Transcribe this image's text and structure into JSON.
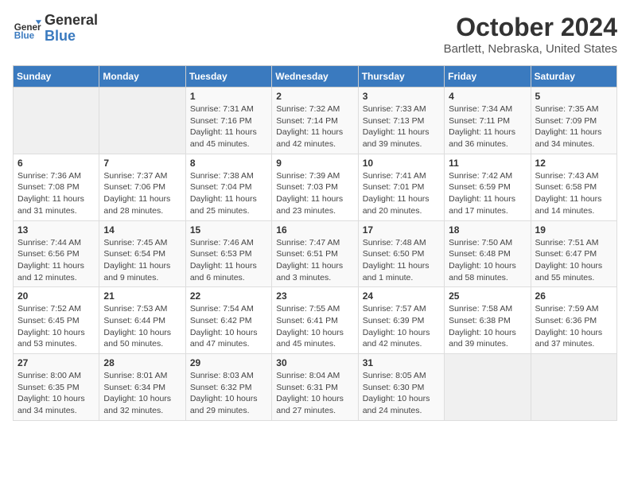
{
  "header": {
    "logo": {
      "general": "General",
      "blue": "Blue"
    },
    "title": "October 2024",
    "location": "Bartlett, Nebraska, United States"
  },
  "days_of_week": [
    "Sunday",
    "Monday",
    "Tuesday",
    "Wednesday",
    "Thursday",
    "Friday",
    "Saturday"
  ],
  "weeks": [
    [
      {
        "day": null
      },
      {
        "day": null
      },
      {
        "day": 1,
        "sunrise": "7:31 AM",
        "sunset": "7:16 PM",
        "daylight": "11 hours and 45 minutes."
      },
      {
        "day": 2,
        "sunrise": "7:32 AM",
        "sunset": "7:14 PM",
        "daylight": "11 hours and 42 minutes."
      },
      {
        "day": 3,
        "sunrise": "7:33 AM",
        "sunset": "7:13 PM",
        "daylight": "11 hours and 39 minutes."
      },
      {
        "day": 4,
        "sunrise": "7:34 AM",
        "sunset": "7:11 PM",
        "daylight": "11 hours and 36 minutes."
      },
      {
        "day": 5,
        "sunrise": "7:35 AM",
        "sunset": "7:09 PM",
        "daylight": "11 hours and 34 minutes."
      }
    ],
    [
      {
        "day": 6,
        "sunrise": "7:36 AM",
        "sunset": "7:08 PM",
        "daylight": "11 hours and 31 minutes."
      },
      {
        "day": 7,
        "sunrise": "7:37 AM",
        "sunset": "7:06 PM",
        "daylight": "11 hours and 28 minutes."
      },
      {
        "day": 8,
        "sunrise": "7:38 AM",
        "sunset": "7:04 PM",
        "daylight": "11 hours and 25 minutes."
      },
      {
        "day": 9,
        "sunrise": "7:39 AM",
        "sunset": "7:03 PM",
        "daylight": "11 hours and 23 minutes."
      },
      {
        "day": 10,
        "sunrise": "7:41 AM",
        "sunset": "7:01 PM",
        "daylight": "11 hours and 20 minutes."
      },
      {
        "day": 11,
        "sunrise": "7:42 AM",
        "sunset": "6:59 PM",
        "daylight": "11 hours and 17 minutes."
      },
      {
        "day": 12,
        "sunrise": "7:43 AM",
        "sunset": "6:58 PM",
        "daylight": "11 hours and 14 minutes."
      }
    ],
    [
      {
        "day": 13,
        "sunrise": "7:44 AM",
        "sunset": "6:56 PM",
        "daylight": "11 hours and 12 minutes."
      },
      {
        "day": 14,
        "sunrise": "7:45 AM",
        "sunset": "6:54 PM",
        "daylight": "11 hours and 9 minutes."
      },
      {
        "day": 15,
        "sunrise": "7:46 AM",
        "sunset": "6:53 PM",
        "daylight": "11 hours and 6 minutes."
      },
      {
        "day": 16,
        "sunrise": "7:47 AM",
        "sunset": "6:51 PM",
        "daylight": "11 hours and 3 minutes."
      },
      {
        "day": 17,
        "sunrise": "7:48 AM",
        "sunset": "6:50 PM",
        "daylight": "11 hours and 1 minute."
      },
      {
        "day": 18,
        "sunrise": "7:50 AM",
        "sunset": "6:48 PM",
        "daylight": "10 hours and 58 minutes."
      },
      {
        "day": 19,
        "sunrise": "7:51 AM",
        "sunset": "6:47 PM",
        "daylight": "10 hours and 55 minutes."
      }
    ],
    [
      {
        "day": 20,
        "sunrise": "7:52 AM",
        "sunset": "6:45 PM",
        "daylight": "10 hours and 53 minutes."
      },
      {
        "day": 21,
        "sunrise": "7:53 AM",
        "sunset": "6:44 PM",
        "daylight": "10 hours and 50 minutes."
      },
      {
        "day": 22,
        "sunrise": "7:54 AM",
        "sunset": "6:42 PM",
        "daylight": "10 hours and 47 minutes."
      },
      {
        "day": 23,
        "sunrise": "7:55 AM",
        "sunset": "6:41 PM",
        "daylight": "10 hours and 45 minutes."
      },
      {
        "day": 24,
        "sunrise": "7:57 AM",
        "sunset": "6:39 PM",
        "daylight": "10 hours and 42 minutes."
      },
      {
        "day": 25,
        "sunrise": "7:58 AM",
        "sunset": "6:38 PM",
        "daylight": "10 hours and 39 minutes."
      },
      {
        "day": 26,
        "sunrise": "7:59 AM",
        "sunset": "6:36 PM",
        "daylight": "10 hours and 37 minutes."
      }
    ],
    [
      {
        "day": 27,
        "sunrise": "8:00 AM",
        "sunset": "6:35 PM",
        "daylight": "10 hours and 34 minutes."
      },
      {
        "day": 28,
        "sunrise": "8:01 AM",
        "sunset": "6:34 PM",
        "daylight": "10 hours and 32 minutes."
      },
      {
        "day": 29,
        "sunrise": "8:03 AM",
        "sunset": "6:32 PM",
        "daylight": "10 hours and 29 minutes."
      },
      {
        "day": 30,
        "sunrise": "8:04 AM",
        "sunset": "6:31 PM",
        "daylight": "10 hours and 27 minutes."
      },
      {
        "day": 31,
        "sunrise": "8:05 AM",
        "sunset": "6:30 PM",
        "daylight": "10 hours and 24 minutes."
      },
      {
        "day": null
      },
      {
        "day": null
      }
    ]
  ]
}
